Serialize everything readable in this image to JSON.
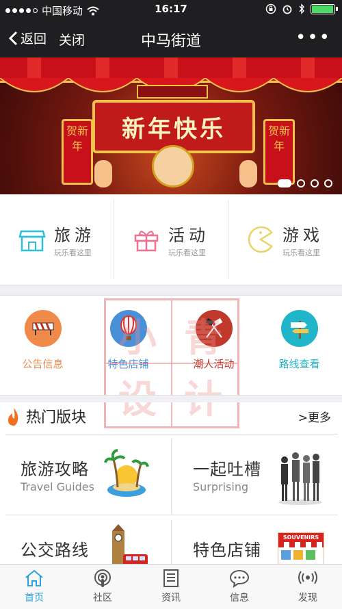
{
  "status": {
    "carrier": "中国移动",
    "time": "16:17",
    "battery_level": 0.92
  },
  "nav": {
    "back_label": "返回",
    "close_label": "关闭",
    "title": "中马街道",
    "more_label": "•••"
  },
  "banner": {
    "headline": "新年快乐",
    "lantern_text": "贺新年",
    "slides": 4,
    "active_slide": 1
  },
  "categories": [
    {
      "name": "旅游",
      "sub": "玩乐看这里",
      "icon": "shop-icon",
      "color": "#29c0d8"
    },
    {
      "name": "活动",
      "sub": "玩乐看这里",
      "icon": "gift-icon",
      "color": "#f07090"
    },
    {
      "name": "游戏",
      "sub": "玩乐看这里",
      "icon": "pacman-icon",
      "color": "#e8d46a"
    }
  ],
  "quick_links": [
    {
      "label": "公告信息",
      "icon": "barrier-icon",
      "color": "#f08a4b"
    },
    {
      "label": "特色店铺",
      "icon": "balloon-icon",
      "color": "#4a90d9"
    },
    {
      "label": "潮人活动",
      "icon": "flags-icon",
      "color": "#c0392b"
    },
    {
      "label": "路线查看",
      "icon": "signpost-icon",
      "color": "#20b5c8"
    }
  ],
  "watermark": [
    "小",
    "青",
    "设",
    "计"
  ],
  "hot": {
    "title": "热门版块",
    "more_label": ">更多"
  },
  "cards": [
    {
      "name": "旅游攻略",
      "en": "Travel Guides",
      "icon": "island-icon"
    },
    {
      "name": "一起吐槽",
      "en": "Surprising",
      "icon": "people-icon"
    },
    {
      "name": "公交路线",
      "en": "",
      "icon": "bus-icon"
    },
    {
      "name": "特色店铺",
      "en": "",
      "icon": "souvenir-shop-icon",
      "badge": "SOUVENIRS"
    }
  ],
  "tabs": [
    {
      "label": "首页",
      "icon": "home-icon",
      "active": true
    },
    {
      "label": "社区",
      "icon": "podcast-icon",
      "active": false
    },
    {
      "label": "资讯",
      "icon": "document-icon",
      "active": false
    },
    {
      "label": "信息",
      "icon": "chat-icon",
      "active": false
    },
    {
      "label": "发现",
      "icon": "broadcast-icon",
      "active": false
    }
  ],
  "colors": {
    "accent": "#2ca1e0",
    "bar": "#1f1f22"
  }
}
